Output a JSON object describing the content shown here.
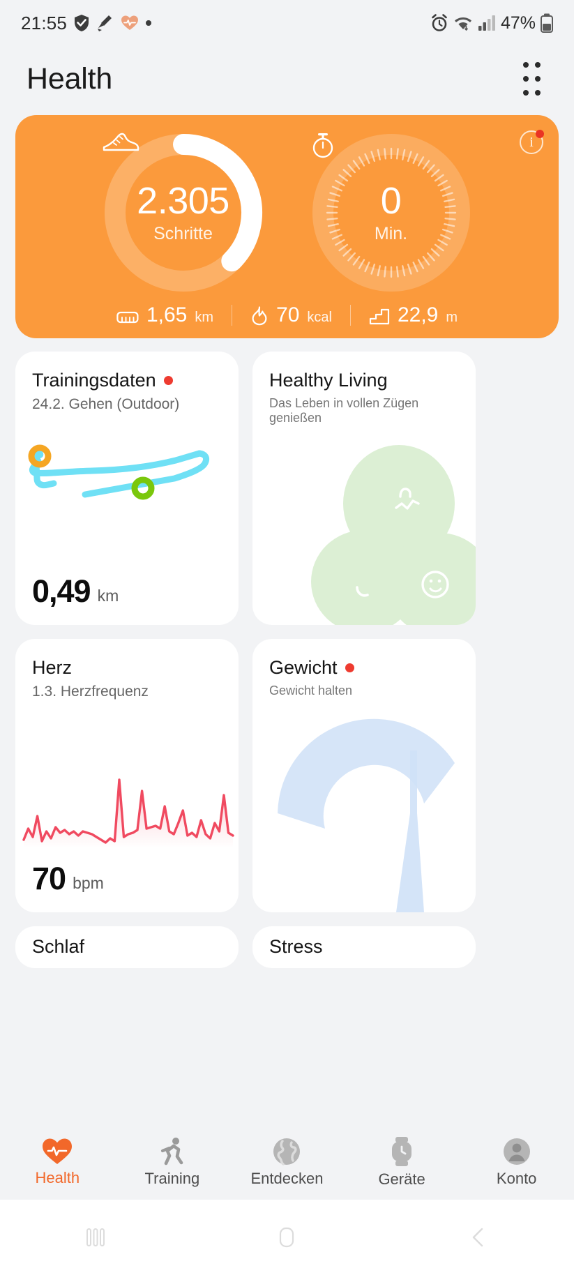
{
  "status_bar": {
    "time": "21:55",
    "battery": "47%",
    "left_icons": [
      "shield-icon",
      "broom-icon",
      "heart-icon",
      "dot-icon"
    ],
    "right_icons": [
      "alarm-icon",
      "wifi-icon",
      "signal-icon",
      "battery-icon"
    ]
  },
  "header": {
    "title": "Health",
    "more_icon": "more-options-icon"
  },
  "summary": {
    "info_icon": "info-icon",
    "steps": {
      "icon": "shoe-icon",
      "value": "2.305",
      "label": "Schritte",
      "progress_percent": 38
    },
    "minutes": {
      "icon": "stopwatch-icon",
      "value": "0",
      "label": "Min.",
      "progress_percent": 0
    },
    "stats": [
      {
        "icon": "ruler-icon",
        "value": "1,65",
        "unit": "km"
      },
      {
        "icon": "flame-icon",
        "value": "70",
        "unit": "kcal"
      },
      {
        "icon": "stairs-icon",
        "value": "22,9",
        "unit": "m"
      }
    ],
    "accent": "#fb9a3c"
  },
  "tiles": {
    "training": {
      "title": "Trainingsdaten",
      "has_badge": true,
      "subtitle": "24.2.  Gehen (Outdoor)",
      "value": "0,49",
      "unit": "km",
      "route_color": "#6fe0f5",
      "start_marker_color": "#f5a623",
      "end_marker_color": "#7ac70c"
    },
    "healthy_living": {
      "title": "Healthy Living",
      "has_badge": false,
      "subtitle": "Das Leben in vollen Zügen genießen",
      "art": "clover-leaves-illustration",
      "art_color": "#dcefd4"
    },
    "heart": {
      "title": "Herz",
      "has_badge": false,
      "subtitle": "1.3.  Herzfrequenz",
      "value": "70",
      "unit": "bpm",
      "line_color": "#f04a60"
    },
    "weight": {
      "title": "Gewicht",
      "has_badge": true,
      "subtitle": "Gewicht halten",
      "art": "scale-gauge-illustration",
      "art_color": "#cfe1f7"
    },
    "sleep": {
      "title": "Schlaf"
    },
    "stress": {
      "title": "Stress"
    }
  },
  "chart_data": {
    "type": "line",
    "title": "Herzfrequenz",
    "ylabel": "bpm",
    "xlabel": "",
    "grid": false,
    "legend": "none",
    "values": [
      62,
      78,
      66,
      96,
      60,
      74,
      64,
      80,
      72,
      76,
      70,
      74,
      68,
      74,
      72,
      70,
      66,
      62,
      58,
      64,
      60,
      148,
      66,
      70,
      72,
      76,
      132,
      78,
      80,
      82,
      78,
      110,
      74,
      70,
      86,
      104,
      68,
      72,
      66,
      90,
      70,
      64,
      86,
      74,
      126,
      72,
      68
    ],
    "ylim": [
      50,
      160
    ]
  },
  "bottom_nav": {
    "items": [
      {
        "icon": "heart-pulse-icon",
        "label": "Health",
        "active": true
      },
      {
        "icon": "running-icon",
        "label": "Training",
        "active": false
      },
      {
        "icon": "globe-icon",
        "label": "Entdecken",
        "active": false
      },
      {
        "icon": "watch-icon",
        "label": "Geräte",
        "active": false
      },
      {
        "icon": "account-icon",
        "label": "Konto",
        "active": false
      }
    ],
    "active_color": "#f2682a"
  },
  "system_nav": {
    "items": [
      "recents-icon",
      "home-icon",
      "back-icon"
    ]
  }
}
